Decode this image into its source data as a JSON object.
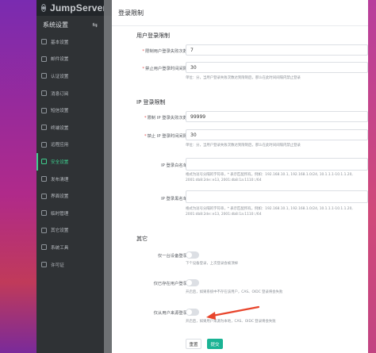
{
  "app": {
    "brand": "JumpServer"
  },
  "sidebar": {
    "header": "系统设置",
    "items": [
      {
        "label": "基本设置",
        "icon": "gear-icon"
      },
      {
        "label": "邮件设置",
        "icon": "mail-icon"
      },
      {
        "label": "认证设置",
        "icon": "user-icon"
      },
      {
        "label": "消息订阅",
        "icon": "bell-icon"
      },
      {
        "label": "短信设置",
        "icon": "sms-icon"
      },
      {
        "label": "终端设置",
        "icon": "terminal-icon"
      },
      {
        "label": "远程应用",
        "icon": "app-icon"
      },
      {
        "label": "安全设置",
        "icon": "shield-icon",
        "active": true
      },
      {
        "label": "发布清理",
        "icon": "clean-icon"
      },
      {
        "label": "界面设置",
        "icon": "palette-icon"
      },
      {
        "label": "临时管理",
        "icon": "clock-icon"
      },
      {
        "label": "其它设置",
        "icon": "more-icon"
      },
      {
        "label": "系统工具",
        "icon": "tool-icon"
      },
      {
        "label": "许可证",
        "icon": "license-icon"
      }
    ]
  },
  "drawer": {
    "title": "登录限制",
    "user_section": {
      "title": "用户登录限制",
      "fail_times_label": "限制用户登录失败次数",
      "fail_times_value": "7",
      "block_time_label": "禁止用户登录时间间隔",
      "block_time_value": "30",
      "hint": "单位：分，当用户登录失败次数达到限制后，那么在此时间间隔内禁止登录"
    },
    "ip_section": {
      "title": "IP 登录限制",
      "fail_times_label": "限制 IP 登录失败次数",
      "fail_times_value": "99999",
      "block_time_label": "禁止 IP 登录时间间隔",
      "block_time_value": "30",
      "hint": "单位：分，当用户登录失败次数达到限制后，那么在此时间间隔内禁止登录",
      "whitelist_label": "IP 登录白名单",
      "whitelist_hint": "格式为逗号分隔的字符串，* 表示匹配所有。例如：192.168.10.1, 192.168.1.0/24, 10.1.1.1-10.1.1.20, 2001:db8:2de::e13, 2001:db8:1a:1110::/64",
      "blacklist_label": "IP 登录黑名单",
      "blacklist_hint": "格式为逗号分隔的字符串，* 表示匹配所有。例如：192.168.10.1, 192.168.1.0/24, 10.1.1.1-10.1.1.20, 2001:db8:2de::e13, 2001:db8:1a:1110::/64"
    },
    "other_section": {
      "title": "其它",
      "single_login_label": "仅一台设备登录",
      "single_login_hint": "下个设备登录，上次登录会被顶掉",
      "existing_user_label": "仅已存在用户登录",
      "existing_user_hint": "开启后，如果系统中不存在该用户，CAS、OIDC 登录将会失败",
      "user_source_label": "仅从用户来源登录",
      "user_source_hint": "开启后，如果用户来源为本地，CAS、OIDC 登录将会失败"
    },
    "buttons": {
      "reset": "重置",
      "submit": "提交"
    }
  },
  "colors": {
    "accent": "#1ab394",
    "arrow": "#e8452c",
    "sidebar_bg": "#2f3235",
    "active": "#3ecf8e"
  }
}
